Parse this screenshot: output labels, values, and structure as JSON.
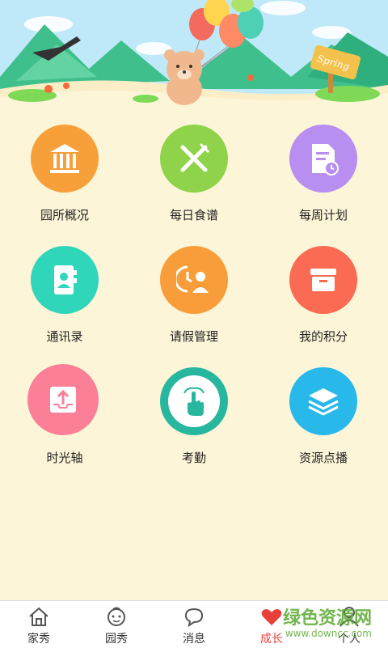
{
  "banner": {
    "sign_text": "Spring"
  },
  "grid": [
    {
      "label": "园所概况",
      "icon": "institution-icon",
      "color": "#f7a03a"
    },
    {
      "label": "每日食谱",
      "icon": "fork-knife-icon",
      "color": "#8fd34a"
    },
    {
      "label": "每周计划",
      "icon": "document-clock-icon",
      "color": "#b88ef0"
    },
    {
      "label": "通讯录",
      "icon": "contacts-book-icon",
      "color": "#2fd6b9"
    },
    {
      "label": "请假管理",
      "icon": "leave-person-icon",
      "color": "#f89d3a"
    },
    {
      "label": "我的积分",
      "icon": "archive-box-icon",
      "color": "#fb6a53"
    },
    {
      "label": "时光轴",
      "icon": "upload-tray-icon",
      "color": "#fb7f97"
    },
    {
      "label": "考勤",
      "icon": "touch-hand-icon",
      "color": "#27b79e"
    },
    {
      "label": "资源点播",
      "icon": "layers-icon",
      "color": "#29b8ea"
    }
  ],
  "tabs": [
    {
      "label": "家秀",
      "icon": "home-icon"
    },
    {
      "label": "园秀",
      "icon": "baby-face-icon"
    },
    {
      "label": "消息",
      "icon": "chat-bubble-icon"
    },
    {
      "label": "成长",
      "icon": "heart-icon",
      "active": true
    },
    {
      "label": "个人",
      "icon": "person-icon"
    }
  ],
  "watermark": {
    "title": "绿色资源网",
    "sub": "www.downcc.com"
  }
}
